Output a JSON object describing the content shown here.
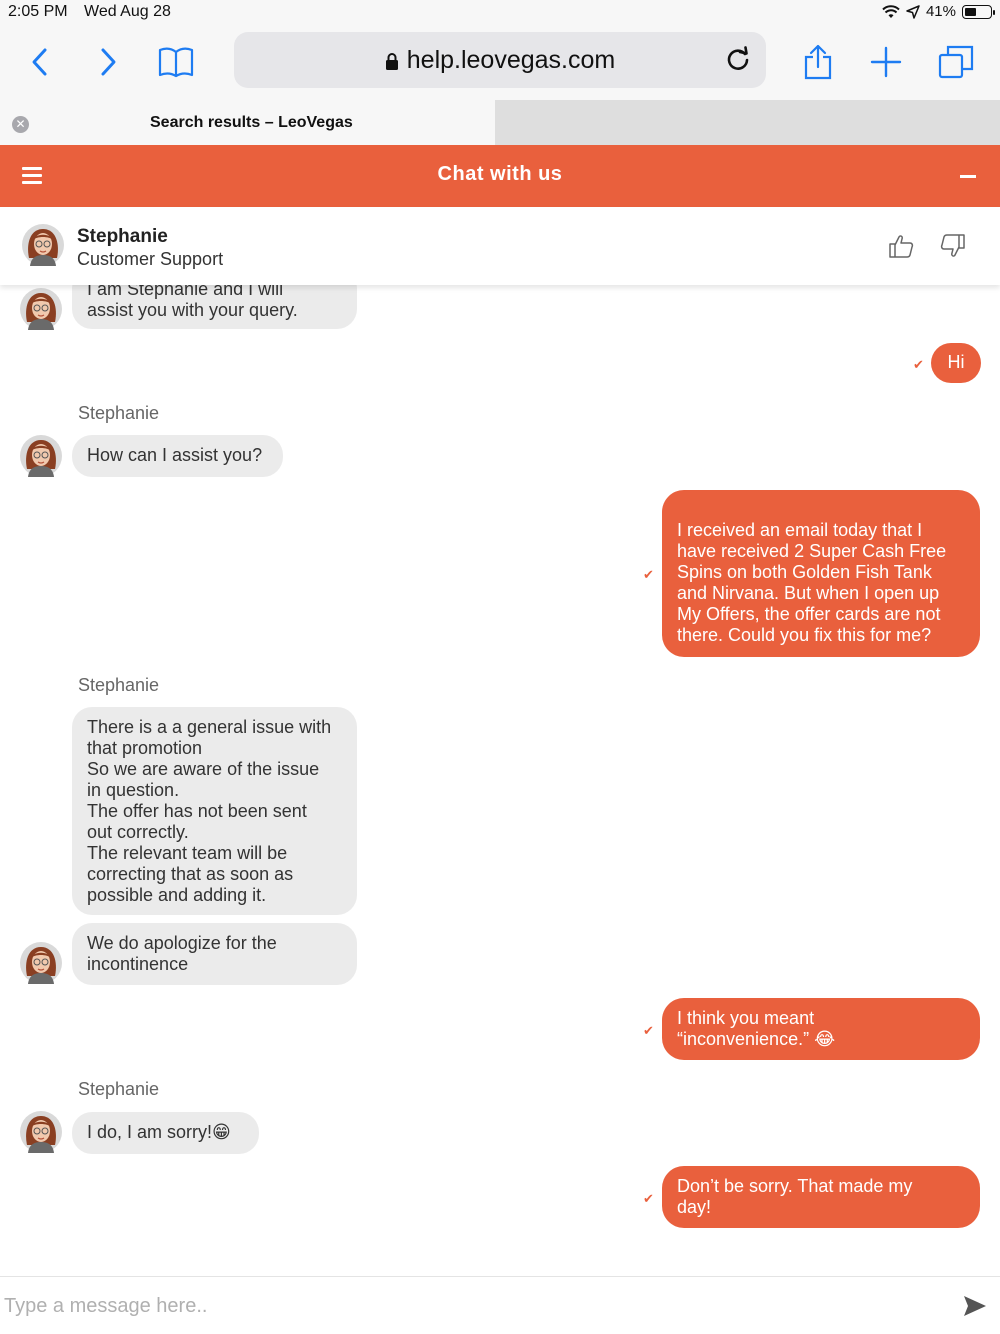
{
  "status": {
    "time": "2:05 PM",
    "date": "Wed Aug 28",
    "battery": "41%"
  },
  "browser": {
    "url": "help.leovegas.com",
    "tab_title": "Search results – LeoVegas"
  },
  "chat": {
    "title": "Chat with us",
    "accent_color": "#e9603d",
    "agent": {
      "name": "Stephanie",
      "role": "Customer Support"
    },
    "messages": [
      {
        "from": "agent",
        "lines": [
          "I am Stephanie and I will",
          "assist you with your query."
        ]
      },
      {
        "from": "user",
        "lines": [
          "Hi"
        ]
      },
      {
        "from": "agent",
        "sender": "Stephanie",
        "lines": [
          "How can I assist you?"
        ]
      },
      {
        "from": "user",
        "lines": [
          "I received an email today that I",
          "have received 2 Super Cash Free",
          "Spins on both Golden Fish Tank",
          "and Nirvana. But when I open up",
          "My Offers, the offer cards are not",
          "there. Could you fix this for me?"
        ]
      },
      {
        "from": "agent",
        "sender": "Stephanie",
        "lines": [
          "There is a a general issue with",
          "that promotion",
          "So we are aware of the issue",
          "in question.",
          "The offer has not been sent",
          "out correctly.",
          "The relevant team will be",
          "correcting that as soon as",
          "possible and adding it."
        ]
      },
      {
        "from": "agent",
        "lines": [
          "We do apologize for the",
          "incontinence"
        ]
      },
      {
        "from": "user",
        "lines": [
          "I think you meant",
          "“inconvenience.” 😂"
        ]
      },
      {
        "from": "agent",
        "sender": "Stephanie",
        "lines": [
          "I do, I am sorry!😁"
        ]
      },
      {
        "from": "user",
        "lines": [
          "Don’t be sorry. That made my",
          "day!"
        ]
      }
    ],
    "input_placeholder": "Type a message here.."
  }
}
